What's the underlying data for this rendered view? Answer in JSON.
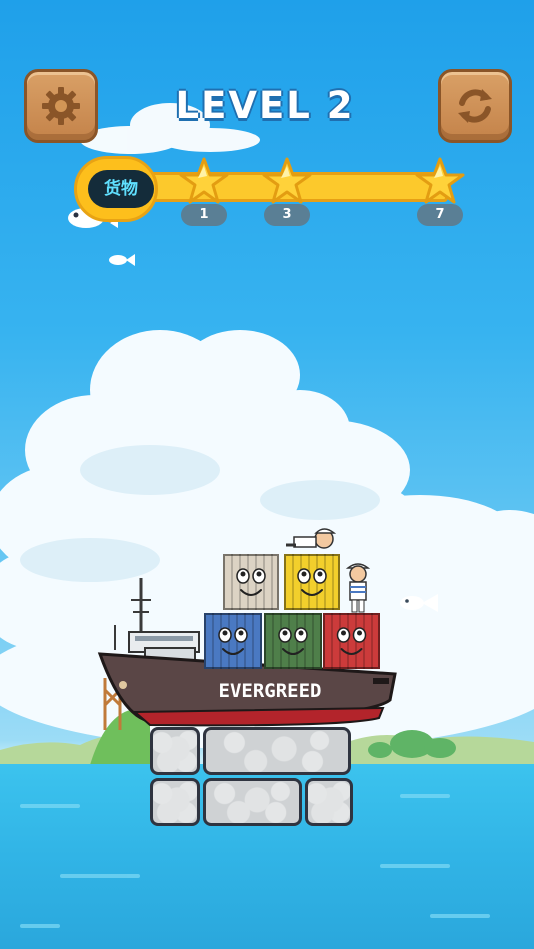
{
  "hud": {
    "level_title": "LEVEL 2",
    "settings_icon": "gear-icon",
    "restart_icon": "refresh-icon",
    "cargo_badge_label": "货物",
    "progress": 0.0,
    "milestones": [
      {
        "label": "1",
        "icon": "star-icon"
      },
      {
        "label": "3",
        "icon": "star-icon"
      },
      {
        "label": "7",
        "icon": "star-icon"
      }
    ]
  },
  "ship": {
    "name": "EVERGREED",
    "hull_color": "#5a4646",
    "stripe_color": "#b3242b"
  },
  "containers": [
    {
      "id": "cream",
      "color": "#dcd3c4"
    },
    {
      "id": "yellow",
      "color": "#f2cf2c"
    },
    {
      "id": "blue",
      "color": "#4a79c2"
    },
    {
      "id": "green",
      "color": "#4f7f4a"
    },
    {
      "id": "red",
      "color": "#cc3b3b"
    }
  ],
  "colors": {
    "sky_top": "#1fa0ea",
    "sea": "#3bbbe6",
    "wood": "#d39656",
    "star": "#ffd23a"
  }
}
